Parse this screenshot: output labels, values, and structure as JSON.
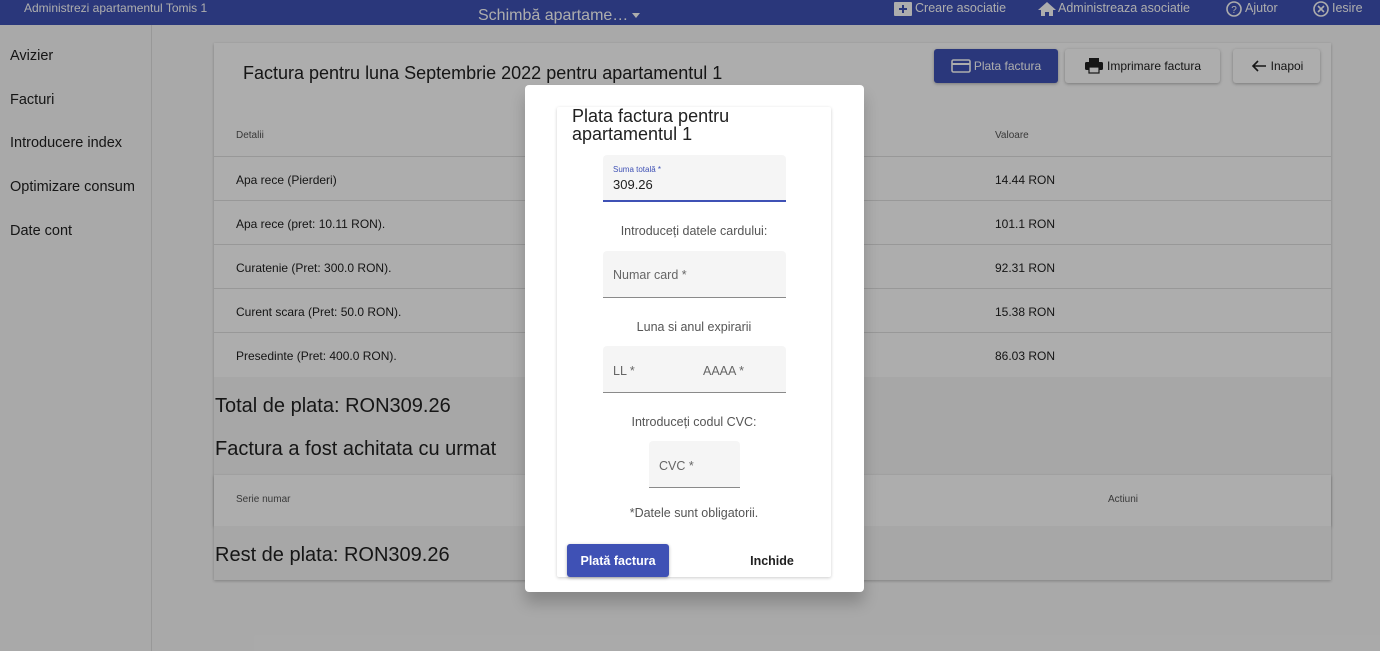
{
  "topbar": {
    "app_title": "Administrezi apartamentul Tomis 1",
    "switch_label": "Schimbă apartame…",
    "nav": [
      {
        "label": "Creare asociatie",
        "icon": "add-box-icon"
      },
      {
        "label": "Administreaza asociatie",
        "icon": "home-icon"
      },
      {
        "label": "Ajutor",
        "icon": "help-icon"
      },
      {
        "label": "Iesire",
        "icon": "close-circle-icon"
      }
    ]
  },
  "sidebar": {
    "items": [
      "Avizier",
      "Facturi",
      "Introducere index",
      "Optimizare consum",
      "Date cont"
    ]
  },
  "invoice": {
    "title": "Factura pentru luna Septembrie 2022 pentru apartamentul 1",
    "buttons": {
      "pay": "Plata factura",
      "print": "Imprimare factura",
      "back": "Inapoi"
    },
    "columns": {
      "details": "Detalii",
      "value": "Valoare"
    },
    "rows": [
      {
        "detail": "Apa rece (Pierderi)",
        "value": "14.44 RON"
      },
      {
        "detail": "Apa rece (pret: 10.11 RON).",
        "value": "101.1 RON"
      },
      {
        "detail": "Curatenie (Pret: 300.0 RON).",
        "value": "92.31 RON"
      },
      {
        "detail": "Curent scara (Pret: 50.0 RON).",
        "value": "15.38 RON"
      },
      {
        "detail": "Presedinte (Pret: 400.0 RON).",
        "value": "86.03 RON"
      }
    ],
    "total": "Total de plata: RON309.26",
    "paid_with": "Factura a fost achitata cu urmat",
    "payments_columns": {
      "serial": "Serie numar",
      "actions": "Actiuni"
    },
    "rest": "Rest de plata: RON309.26"
  },
  "dialog": {
    "title": "Plata factura pentru apartamentul 1",
    "total_label": "Suma totală *",
    "total_value": "309.26",
    "card_caption": "Introduceți datele cardului:",
    "card_placeholder": "Numar card *",
    "expiry_caption": "Luna si anul expirarii",
    "month_placeholder": "LL *",
    "year_placeholder": "AAAA *",
    "cvc_caption": "Introduceți codul CVC:",
    "cvc_placeholder": "CVC *",
    "required_note": "*Datele sunt obligatorii.",
    "pay_button": "Plată factura",
    "close_button": "Inchide"
  },
  "colors": {
    "primary": "#3f51b5",
    "overlay": "rgba(0,0,0,0.32)"
  }
}
